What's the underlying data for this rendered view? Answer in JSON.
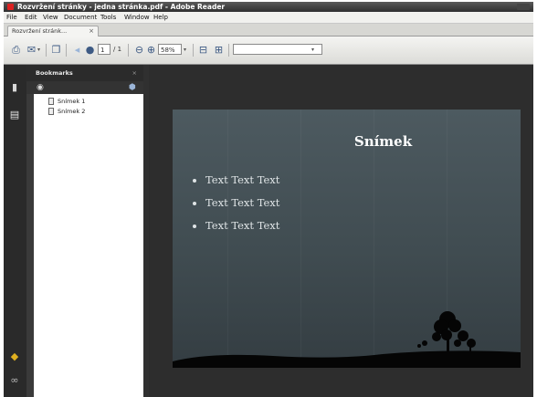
{
  "window": {
    "title": "Rozvržení stránky - jedna stránka.pdf - Adobe Reader"
  },
  "menu": {
    "items": [
      "File",
      "Edit",
      "View",
      "Document",
      "Tools",
      "Window",
      "Help"
    ]
  },
  "tab": {
    "label": "Rozvržení stránk...",
    "close": "×"
  },
  "toolbar": {
    "page_number": "1",
    "page_total": "/ 1",
    "zoom": "58%",
    "find_placeholder": "",
    "icons": [
      "print-icon",
      "email-icon",
      "pages-icon",
      "prev-page-icon",
      "next-page-icon",
      "zoom-out-icon",
      "zoom-in-icon",
      "fit-page-icon",
      "fit-width-icon",
      "find-icon"
    ]
  },
  "sidebar": {
    "title": "Bookmarks",
    "close": "×",
    "bookmarks": [
      "Snímek 1",
      "Snímek 2"
    ]
  },
  "slide": {
    "title": "Snímek",
    "bullets": [
      "Text Text Text",
      "Text Text Text",
      "Text Text Text"
    ]
  },
  "colors": {
    "app_background": "#2d2d2d",
    "toolbar_icon": "#3d5a84",
    "slide_top": "#4d5a60",
    "slide_bottom": "#343d42"
  }
}
